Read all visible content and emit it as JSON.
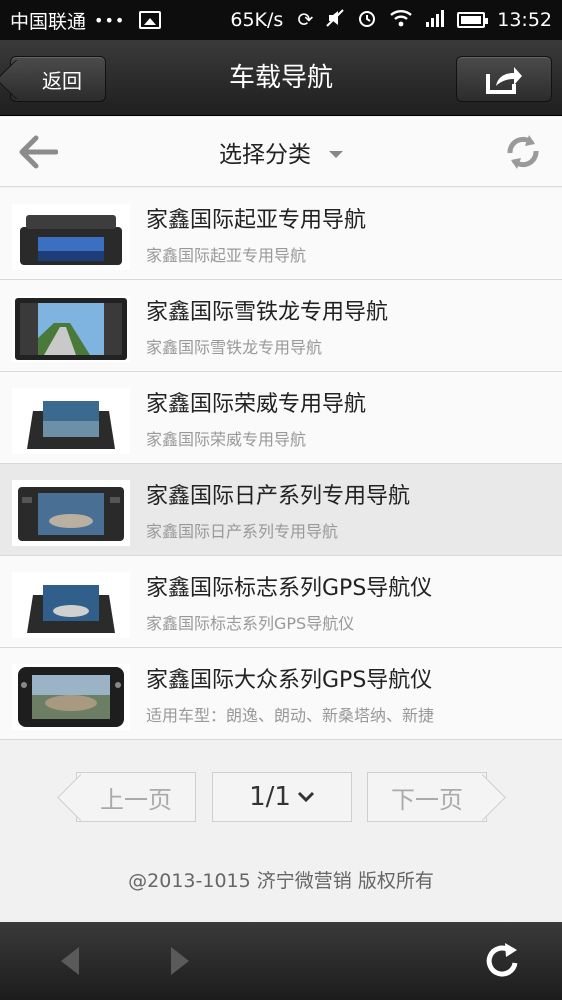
{
  "status_bar": {
    "carrier": "中国联通",
    "dots": "•••",
    "speed": "65K/s",
    "time": "13:52"
  },
  "header": {
    "back_label": "返回",
    "title": "车载导航"
  },
  "category_bar": {
    "selected": "选择分类"
  },
  "items": [
    {
      "title": "家鑫国际起亚专用导航",
      "subtitle": "家鑫国际起亚专用导航"
    },
    {
      "title": "家鑫国际雪铁龙专用导航",
      "subtitle": "家鑫国际雪铁龙专用导航"
    },
    {
      "title": "家鑫国际荣威专用导航",
      "subtitle": "家鑫国际荣威专用导航"
    },
    {
      "title": "家鑫国际日产系列专用导航",
      "subtitle": "家鑫国际日产系列专用导航"
    },
    {
      "title": "家鑫国际标志系列GPS导航仪",
      "subtitle": "家鑫国际标志系列GPS导航仪"
    },
    {
      "title": "家鑫国际大众系列GPS导航仪",
      "subtitle": "适用车型：朗逸、朗动、新桑塔纳、新捷"
    }
  ],
  "pager": {
    "prev_label": "上一页",
    "page": "1/1",
    "next_label": "下一页"
  },
  "footer": {
    "copyright": "@2013-1015 济宁微营销 版权所有"
  },
  "colors": {
    "header_bg": "#2b2b2b",
    "highlight_row": "#e9e9e9"
  }
}
